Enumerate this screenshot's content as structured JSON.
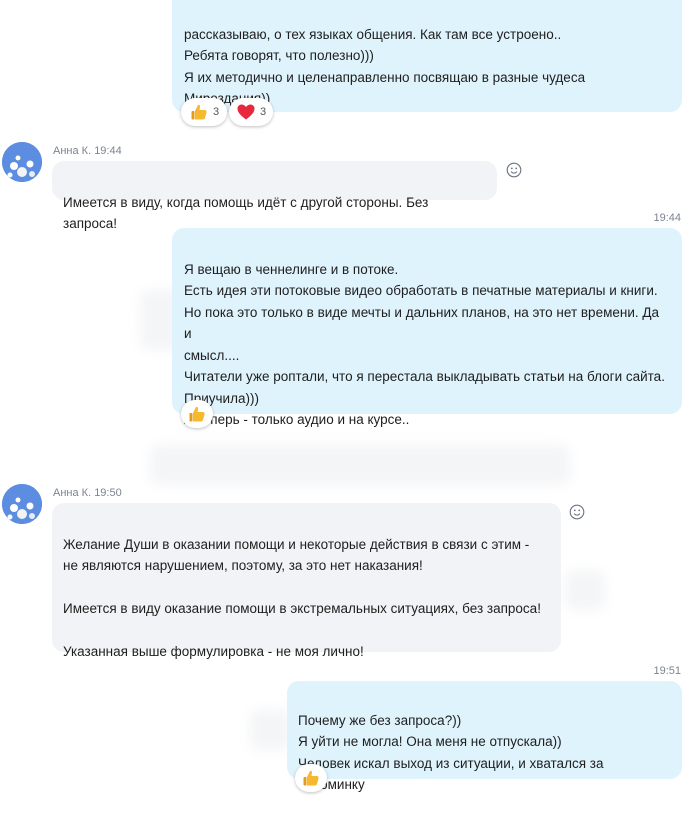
{
  "messages": [
    {
      "id": "m1",
      "direction": "outgoing",
      "text": "рассказываю, о тех языках общения. Как там все устроено..\nРебята говорят, что полезно)))\nЯ их методично и целенаправленно посвящаю в разные чудеса\nМироздания))",
      "reactions": [
        {
          "icon": "thumbs-up-icon",
          "count": "3"
        },
        {
          "icon": "heart-icon",
          "count": "3"
        }
      ]
    },
    {
      "id": "m2",
      "direction": "incoming",
      "sender": "Анна К.",
      "time": "19:44",
      "text": "Имеется в виду, когда помощь идёт с другой стороны. Без запроса!"
    },
    {
      "id": "m3",
      "direction": "outgoing",
      "time": "19:44",
      "text": "Я вещаю в ченнелинге и в потоке.\nЕсть идея эти потоковые видео обработать в печатные материалы и книги.\nНо пока это только в виде мечты и дальних планов, на это нет времени. Да и\nсмысл....\nЧитатели уже роптали, что я перестала выкладывать статьи на блоги сайта.\nПриучила)))\nА теперь - только аудио и на курсе..",
      "reactions": [
        {
          "icon": "thumbs-up-icon"
        }
      ]
    },
    {
      "id": "m4",
      "direction": "incoming",
      "sender": "Анна К.",
      "time": "19:50",
      "text": "Желание Души в оказании помощи и некоторые действия в связи с этим -\nне являются нарушением, поэтому, за это нет наказания!\n\nИмеется в виду оказание помощи в экстремальных ситуациях, без запроса!\n\nУказанная выше формулировка - не моя лично!"
    },
    {
      "id": "m5",
      "direction": "outgoing",
      "time": "19:51",
      "text": "Почему же без запроса?))\nЯ уйти не могла! Она меня не отпускала))\nЧеловек искал выход из ситуации, и хватался за соломинку",
      "reactions": [
        {
          "icon": "thumbs-up-icon"
        }
      ]
    }
  ],
  "colors": {
    "outgoing_bubble": "#dff3fc",
    "incoming_bubble": "#f1f3f6",
    "meta_text": "#7b8490",
    "thumbs_up": "#f5b82e",
    "heart": "#e8283c"
  }
}
